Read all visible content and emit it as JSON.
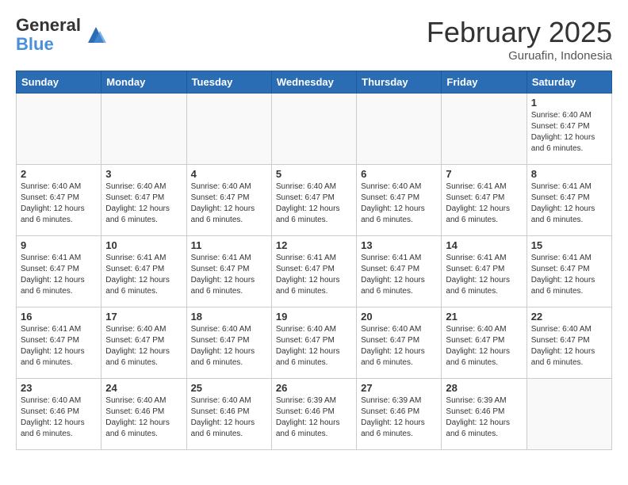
{
  "logo": {
    "general": "General",
    "blue": "Blue"
  },
  "header": {
    "title": "February 2025",
    "subtitle": "Guruafin, Indonesia"
  },
  "weekdays": [
    "Sunday",
    "Monday",
    "Tuesday",
    "Wednesday",
    "Thursday",
    "Friday",
    "Saturday"
  ],
  "weeks": [
    [
      {
        "day": "",
        "info": ""
      },
      {
        "day": "",
        "info": ""
      },
      {
        "day": "",
        "info": ""
      },
      {
        "day": "",
        "info": ""
      },
      {
        "day": "",
        "info": ""
      },
      {
        "day": "",
        "info": ""
      },
      {
        "day": "1",
        "info": "Sunrise: 6:40 AM\nSunset: 6:47 PM\nDaylight: 12 hours\nand 6 minutes."
      }
    ],
    [
      {
        "day": "2",
        "info": "Sunrise: 6:40 AM\nSunset: 6:47 PM\nDaylight: 12 hours\nand 6 minutes."
      },
      {
        "day": "3",
        "info": "Sunrise: 6:40 AM\nSunset: 6:47 PM\nDaylight: 12 hours\nand 6 minutes."
      },
      {
        "day": "4",
        "info": "Sunrise: 6:40 AM\nSunset: 6:47 PM\nDaylight: 12 hours\nand 6 minutes."
      },
      {
        "day": "5",
        "info": "Sunrise: 6:40 AM\nSunset: 6:47 PM\nDaylight: 12 hours\nand 6 minutes."
      },
      {
        "day": "6",
        "info": "Sunrise: 6:40 AM\nSunset: 6:47 PM\nDaylight: 12 hours\nand 6 minutes."
      },
      {
        "day": "7",
        "info": "Sunrise: 6:41 AM\nSunset: 6:47 PM\nDaylight: 12 hours\nand 6 minutes."
      },
      {
        "day": "8",
        "info": "Sunrise: 6:41 AM\nSunset: 6:47 PM\nDaylight: 12 hours\nand 6 minutes."
      }
    ],
    [
      {
        "day": "9",
        "info": "Sunrise: 6:41 AM\nSunset: 6:47 PM\nDaylight: 12 hours\nand 6 minutes."
      },
      {
        "day": "10",
        "info": "Sunrise: 6:41 AM\nSunset: 6:47 PM\nDaylight: 12 hours\nand 6 minutes."
      },
      {
        "day": "11",
        "info": "Sunrise: 6:41 AM\nSunset: 6:47 PM\nDaylight: 12 hours\nand 6 minutes."
      },
      {
        "day": "12",
        "info": "Sunrise: 6:41 AM\nSunset: 6:47 PM\nDaylight: 12 hours\nand 6 minutes."
      },
      {
        "day": "13",
        "info": "Sunrise: 6:41 AM\nSunset: 6:47 PM\nDaylight: 12 hours\nand 6 minutes."
      },
      {
        "day": "14",
        "info": "Sunrise: 6:41 AM\nSunset: 6:47 PM\nDaylight: 12 hours\nand 6 minutes."
      },
      {
        "day": "15",
        "info": "Sunrise: 6:41 AM\nSunset: 6:47 PM\nDaylight: 12 hours\nand 6 minutes."
      }
    ],
    [
      {
        "day": "16",
        "info": "Sunrise: 6:41 AM\nSunset: 6:47 PM\nDaylight: 12 hours\nand 6 minutes."
      },
      {
        "day": "17",
        "info": "Sunrise: 6:40 AM\nSunset: 6:47 PM\nDaylight: 12 hours\nand 6 minutes."
      },
      {
        "day": "18",
        "info": "Sunrise: 6:40 AM\nSunset: 6:47 PM\nDaylight: 12 hours\nand 6 minutes."
      },
      {
        "day": "19",
        "info": "Sunrise: 6:40 AM\nSunset: 6:47 PM\nDaylight: 12 hours\nand 6 minutes."
      },
      {
        "day": "20",
        "info": "Sunrise: 6:40 AM\nSunset: 6:47 PM\nDaylight: 12 hours\nand 6 minutes."
      },
      {
        "day": "21",
        "info": "Sunrise: 6:40 AM\nSunset: 6:47 PM\nDaylight: 12 hours\nand 6 minutes."
      },
      {
        "day": "22",
        "info": "Sunrise: 6:40 AM\nSunset: 6:47 PM\nDaylight: 12 hours\nand 6 minutes."
      }
    ],
    [
      {
        "day": "23",
        "info": "Sunrise: 6:40 AM\nSunset: 6:46 PM\nDaylight: 12 hours\nand 6 minutes."
      },
      {
        "day": "24",
        "info": "Sunrise: 6:40 AM\nSunset: 6:46 PM\nDaylight: 12 hours\nand 6 minutes."
      },
      {
        "day": "25",
        "info": "Sunrise: 6:40 AM\nSunset: 6:46 PM\nDaylight: 12 hours\nand 6 minutes."
      },
      {
        "day": "26",
        "info": "Sunrise: 6:39 AM\nSunset: 6:46 PM\nDaylight: 12 hours\nand 6 minutes."
      },
      {
        "day": "27",
        "info": "Sunrise: 6:39 AM\nSunset: 6:46 PM\nDaylight: 12 hours\nand 6 minutes."
      },
      {
        "day": "28",
        "info": "Sunrise: 6:39 AM\nSunset: 6:46 PM\nDaylight: 12 hours\nand 6 minutes."
      },
      {
        "day": "",
        "info": ""
      }
    ]
  ]
}
